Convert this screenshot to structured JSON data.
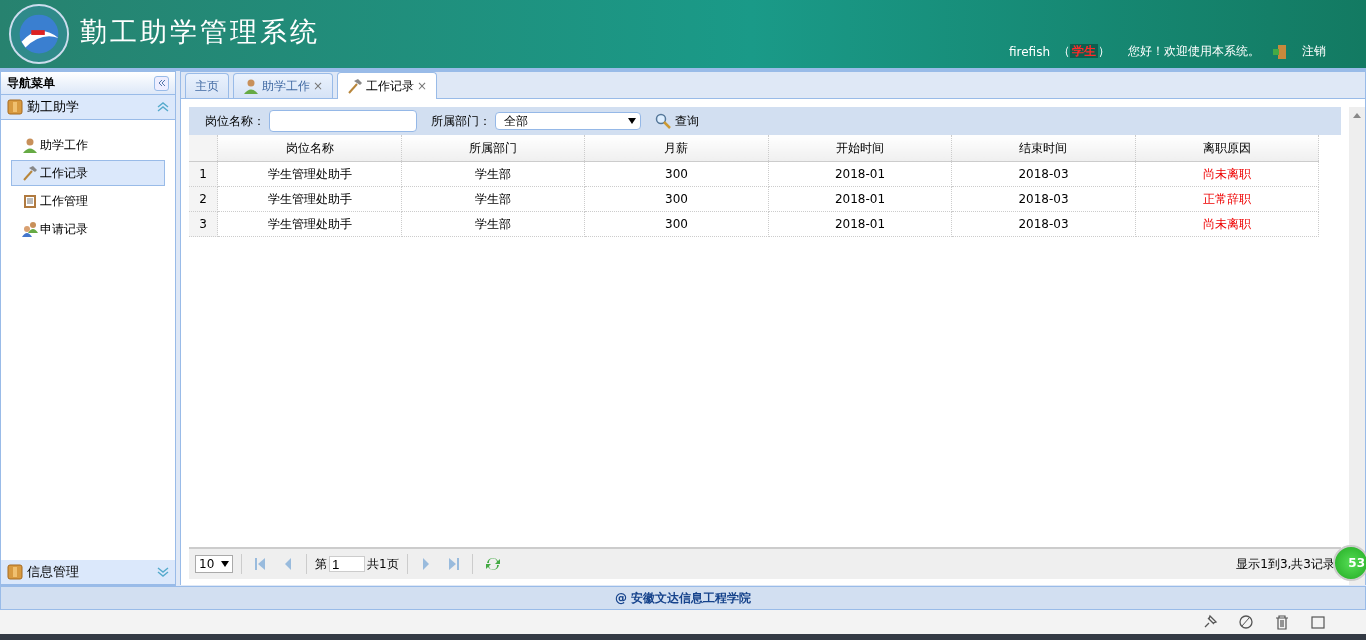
{
  "header": {
    "title": "勤工助学管理系统",
    "user": "firefish",
    "paren_open": "（",
    "role": "学生",
    "paren_close": "）",
    "greeting": "您好！欢迎使用本系统。",
    "logout": "注销"
  },
  "sidebar": {
    "title": "导航菜单",
    "sections": [
      {
        "title": "勤工助学",
        "expanded": true,
        "items": [
          {
            "label": "助学工作",
            "kind": "person",
            "selected": false
          },
          {
            "label": "工作记录",
            "kind": "hammer",
            "selected": true
          },
          {
            "label": "工作管理",
            "kind": "clipboard",
            "selected": false
          },
          {
            "label": "申请记录",
            "kind": "group",
            "selected": false
          }
        ]
      },
      {
        "title": "信息管理",
        "expanded": false
      }
    ]
  },
  "tabs": [
    {
      "label": "主页",
      "kind": "home",
      "closable": false,
      "selected": false
    },
    {
      "label": "助学工作",
      "kind": "person",
      "closable": true,
      "selected": false
    },
    {
      "label": "工作记录",
      "kind": "hammer",
      "closable": true,
      "selected": true
    }
  ],
  "close_glyph": "×",
  "filters": {
    "name_label": "岗位名称：",
    "dept_label": "所属部门：",
    "dept_value": "全部",
    "query": "查询"
  },
  "table": {
    "columns": [
      "岗位名称",
      "所属部门",
      "月薪",
      "开始时间",
      "结束时间",
      "离职原因"
    ],
    "rows": [
      {
        "index": "1",
        "cells": [
          "学生管理处助手",
          "学生部",
          "300",
          "2018-01",
          "2018-03",
          "尚未离职"
        ]
      },
      {
        "index": "2",
        "cells": [
          "学生管理处助手",
          "学生部",
          "300",
          "2018-01",
          "2018-03",
          "正常辞职"
        ]
      },
      {
        "index": "3",
        "cells": [
          "学生管理处助手",
          "学生部",
          "300",
          "2018-01",
          "2018-03",
          "尚未离职"
        ]
      }
    ]
  },
  "pager": {
    "page_size": "10",
    "page_prefix": "第",
    "page": "1",
    "page_suffix": "共1页",
    "summary": "显示1到3,共3记录"
  },
  "footer": "@ 安徽文达信息工程学院",
  "badge": "53"
}
